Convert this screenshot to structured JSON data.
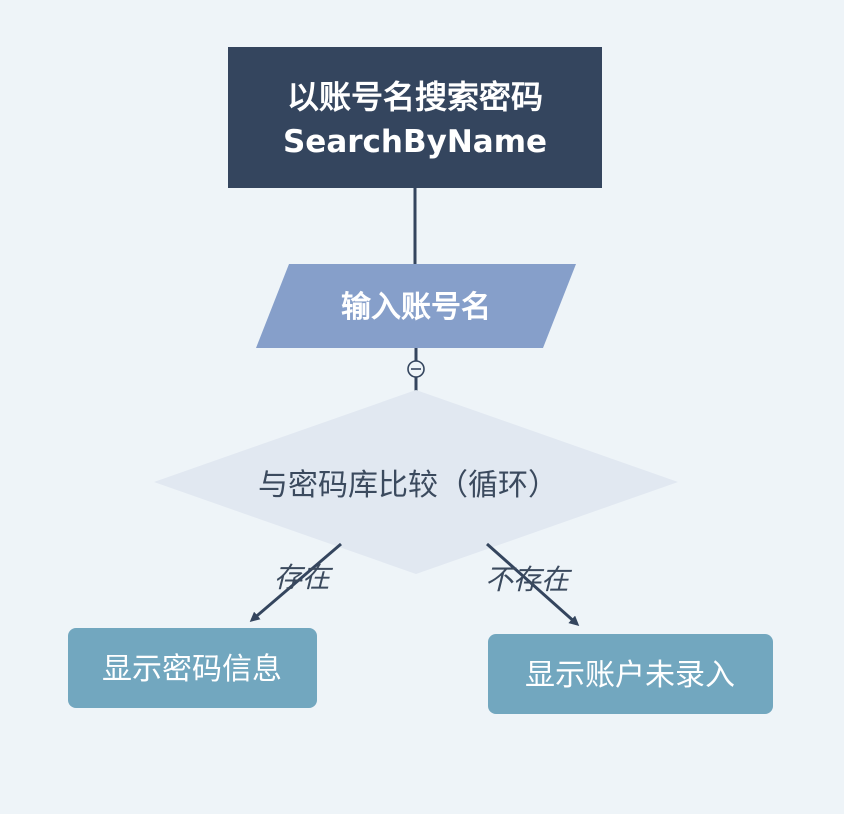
{
  "diagram": {
    "start": {
      "title": "以账号名搜索密码",
      "subtitle": "SearchByName"
    },
    "input": {
      "label": "输入账号名"
    },
    "decision": {
      "label": "与密码库比较（循环）"
    },
    "branch_yes": {
      "edge_label": "存在",
      "result": "显示密码信息"
    },
    "branch_no": {
      "edge_label": "不存在",
      "result": "显示账户未录入"
    }
  },
  "colors": {
    "background": "#eef4f8",
    "start_box": "#34455e",
    "input_box": "#869fca",
    "decision_box": "#e1e8f1",
    "result_box": "#72a7bf",
    "connector": "#34455e"
  },
  "icons": {
    "collapse": "collapse-minus-icon"
  }
}
